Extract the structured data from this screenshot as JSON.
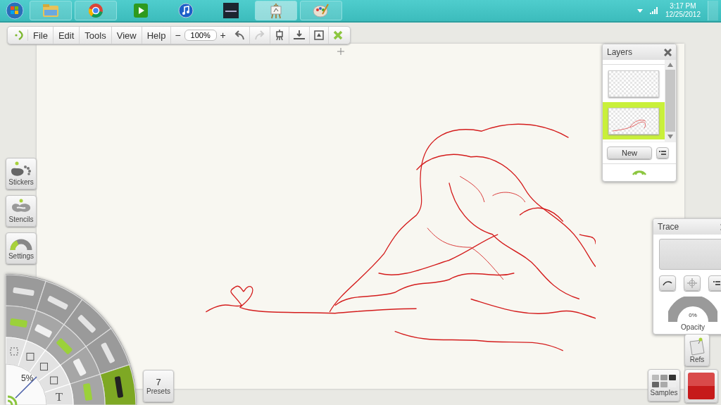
{
  "taskbar": {
    "apps": [
      {
        "running": true,
        "selected": false
      },
      {
        "running": true,
        "selected": false
      },
      {
        "running": false,
        "selected": false
      },
      {
        "running": false,
        "selected": false
      },
      {
        "running": false,
        "selected": false
      },
      {
        "running": true,
        "selected": true
      },
      {
        "running": true,
        "selected": false
      }
    ],
    "time": "3:17 PM",
    "date": "12/25/2012"
  },
  "toolbar": {
    "menus": [
      "File",
      "Edit",
      "Tools",
      "View",
      "Help"
    ],
    "zoom_out": "−",
    "zoom": "100%",
    "zoom_in": "+"
  },
  "side_buttons": [
    "Stickers",
    "Stencils",
    "Settings"
  ],
  "tool_wheel": {
    "size": "5%",
    "text_tool": "T",
    "outer": [
      {
        "selected": false
      },
      {
        "selected": false
      },
      {
        "selected": false
      },
      {
        "selected": false
      },
      {
        "selected": true
      }
    ]
  },
  "presets": {
    "count": "7",
    "label": "Presets"
  },
  "layers": {
    "title": "Layers",
    "items": [
      {
        "selected": false
      },
      {
        "selected": true
      }
    ],
    "new_button": "New"
  },
  "trace": {
    "title": "Trace",
    "reading": "0%",
    "label": "Opacity",
    "level": 0
  },
  "refs": "Refs",
  "samples": "Samples"
}
